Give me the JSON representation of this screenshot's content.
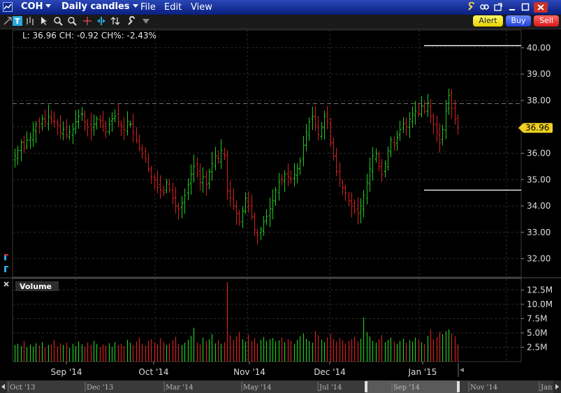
{
  "titlebar": {
    "symbol": "COH",
    "period": "Daily candles",
    "menus": [
      "File",
      "Edit",
      "View"
    ]
  },
  "toolbar": {
    "alert_label": "Alert",
    "buy_label": "Buy",
    "sell_label": "Sell",
    "icons": [
      "text-icon",
      "bar-style-icon",
      "cursor-icon",
      "zoom-in-icon",
      "zoom-out-icon",
      "crosshair-icon",
      "split-icon",
      "arrows-icon",
      "wrench-icon",
      "dropdown-icon"
    ]
  },
  "colors": {
    "up": "#22c822",
    "down": "#d42020",
    "grid": "#2c2c2c",
    "price_tag_bg": "#f0d020",
    "titlebar": "#1a37a8"
  },
  "chart_data": {
    "type": "bar",
    "title": "",
    "readout": "L: 36.96 CH: -0.92 CH%: -2.43%",
    "last_price": "36.96",
    "price_axis": {
      "ticks": [
        "40.00",
        "39.00",
        "38.00",
        "37.00",
        "36.00",
        "35.00",
        "34.00",
        "33.00",
        "32.00"
      ],
      "range": [
        31.3,
        40.7
      ],
      "reference_line": 37.88,
      "upper_band": 40.08,
      "lower_band": 34.6
    },
    "volume_panel": {
      "label": "Volume",
      "ticks": [
        "12.5M",
        "10.0M",
        "7.5M",
        "5.0M",
        "2.5M"
      ],
      "range": [
        0,
        14.5
      ]
    },
    "date_labels": [
      "Sep '14",
      "Oct '14",
      "Nov '14",
      "Dec '14",
      "Jan '15"
    ],
    "navigator_labels": [
      "Oct '13",
      "Dec '13",
      "Mar '14",
      "May '14",
      "Jul '14",
      "Sep '14",
      "Nov '14",
      "Jan '"
    ],
    "close_series": [
      35.9,
      36.1,
      36.4,
      36.2,
      36.5,
      36.6,
      36.9,
      37.1,
      37.0,
      37.3,
      37.2,
      37.4,
      37.3,
      37.2,
      37.1,
      36.8,
      36.9,
      36.7,
      36.8,
      36.9,
      37.2,
      37.4,
      37.5,
      37.2,
      37.0,
      36.9,
      37.1,
      37.3,
      37.2,
      37.0,
      36.8,
      37.1,
      37.3,
      37.4,
      37.2,
      37.0,
      36.9,
      37.2,
      37.1,
      36.8,
      36.5,
      36.2,
      36.0,
      35.8,
      35.4,
      35.1,
      35.0,
      34.7,
      34.6,
      34.5,
      34.9,
      34.6,
      34.3,
      34.0,
      33.9,
      34.1,
      34.4,
      34.8,
      35.2,
      35.5,
      35.2,
      34.9,
      35.1,
      34.8,
      35.3,
      35.6,
      35.9,
      35.8,
      36.1,
      35.9,
      34.6,
      34.3,
      34.0,
      33.7,
      33.4,
      33.8,
      34.3,
      34.0,
      33.6,
      33.1,
      32.9,
      33.1,
      33.4,
      33.6,
      33.9,
      34.2,
      34.6,
      34.9,
      35.0,
      35.2,
      35.1,
      35.0,
      35.2,
      35.4,
      35.7,
      36.3,
      36.8,
      37.2,
      37.4,
      37.1,
      36.7,
      37.0,
      37.4,
      37.2,
      36.4,
      35.9,
      35.3,
      35.0,
      34.7,
      34.5,
      34.2,
      34.0,
      33.8,
      33.7,
      34.0,
      34.4,
      34.9,
      35.4,
      35.9,
      36.0,
      35.5,
      35.2,
      35.6,
      36.1,
      36.5,
      36.3,
      36.6,
      36.9,
      37.1,
      37.0,
      37.3,
      37.5,
      37.6,
      37.5,
      37.8,
      37.6,
      37.9,
      37.4,
      37.1,
      36.8,
      36.4,
      36.9,
      37.6,
      38.2,
      37.7,
      37.3,
      36.96
    ],
    "volume_series": [
      2.9,
      3.1,
      2.7,
      3.6,
      2.5,
      3.0,
      2.6,
      3.2,
      2.8,
      3.4,
      2.5,
      2.9,
      3.0,
      3.8,
      2.6,
      3.2,
      2.9,
      3.3,
      2.4,
      3.1,
      2.7,
      3.5,
      3.0,
      2.6,
      3.3,
      2.9,
      3.6,
      3.1,
      2.5,
      3.0,
      2.8,
      3.2,
      2.6,
      3.4,
      2.9,
      3.1,
      2.7,
      3.8,
      3.3,
      2.9,
      3.5,
      4.2,
      3.1,
      2.8,
      3.6,
      3.9,
      3.3,
      3.0,
      4.1,
      3.4,
      2.9,
      3.2,
      3.7,
      4.3,
      3.1,
      2.9,
      3.3,
      3.8,
      4.5,
      5.9,
      3.4,
      3.0,
      4.2,
      3.6,
      3.9,
      4.8,
      3.2,
      3.7,
      3.1,
      3.4,
      13.9,
      4.6,
      3.8,
      4.4,
      5.2,
      3.9,
      3.5,
      4.7,
      3.6,
      4.1,
      3.2,
      3.8,
      4.3,
      3.6,
      3.9,
      4.1,
      3.5,
      3.7,
      4.2,
      3.4,
      3.9,
      3.6,
      3.1,
      3.8,
      4.4,
      4.9,
      4.0,
      3.6,
      3.3,
      5.3,
      4.6,
      3.8,
      3.4,
      4.2,
      4.8,
      3.9,
      3.5,
      4.1,
      3.7,
      3.2,
      3.6,
      3.9,
      4.3,
      3.5,
      4.0,
      7.7,
      5.1,
      4.4,
      3.6,
      3.3,
      3.9,
      4.6,
      3.4,
      3.8,
      4.2,
      3.5,
      3.1,
      3.6,
      4.0,
      3.3,
      3.7,
      3.5,
      4.2,
      3.8,
      3.4,
      3.1,
      4.5,
      5.6,
      3.9,
      4.3,
      5.2,
      4.8,
      5.3,
      5.6,
      4.9,
      4.4
    ]
  }
}
